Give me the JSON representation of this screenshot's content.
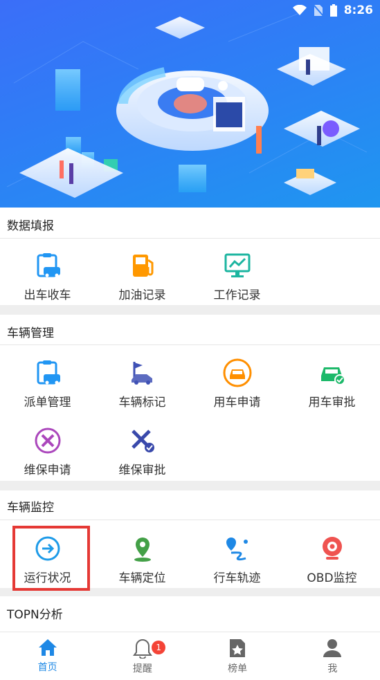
{
  "status_bar": {
    "time": "8:26"
  },
  "sections": {
    "data_report": {
      "title": "数据填报",
      "items": [
        {
          "label": "出车收车",
          "icon": "vehicle-clipboard-icon"
        },
        {
          "label": "加油记录",
          "icon": "fuel-pump-icon"
        },
        {
          "label": "工作记录",
          "icon": "monitor-chart-icon"
        }
      ]
    },
    "vehicle_management": {
      "title": "车辆管理",
      "items": [
        {
          "label": "派单管理",
          "icon": "vehicle-clipboard-icon"
        },
        {
          "label": "车辆标记",
          "icon": "flag-car-icon"
        },
        {
          "label": "用车申请",
          "icon": "car-circle-icon"
        },
        {
          "label": "用车审批",
          "icon": "car-check-icon"
        },
        {
          "label": "维保申请",
          "icon": "tools-circle-icon"
        },
        {
          "label": "维保审批",
          "icon": "wrench-check-icon"
        }
      ]
    },
    "vehicle_monitoring": {
      "title": "车辆监控",
      "items": [
        {
          "label": "运行状况",
          "icon": "run-status-icon"
        },
        {
          "label": "车辆定位",
          "icon": "location-pin-icon"
        },
        {
          "label": "行车轨迹",
          "icon": "route-track-icon"
        },
        {
          "label": "OBD监控",
          "icon": "camera-monitor-icon"
        }
      ]
    },
    "topn": {
      "title": "TOPN分析"
    }
  },
  "tabbar": {
    "tabs": [
      {
        "label": "首页",
        "icon": "home-icon",
        "active": true
      },
      {
        "label": "提醒",
        "icon": "bell-icon",
        "badge": "1"
      },
      {
        "label": "榜单",
        "icon": "ranking-icon"
      },
      {
        "label": "我",
        "icon": "user-icon"
      }
    ]
  },
  "colors": {
    "accent": "#1e88e5",
    "highlight": "#e53935",
    "badge": "#f44336"
  }
}
